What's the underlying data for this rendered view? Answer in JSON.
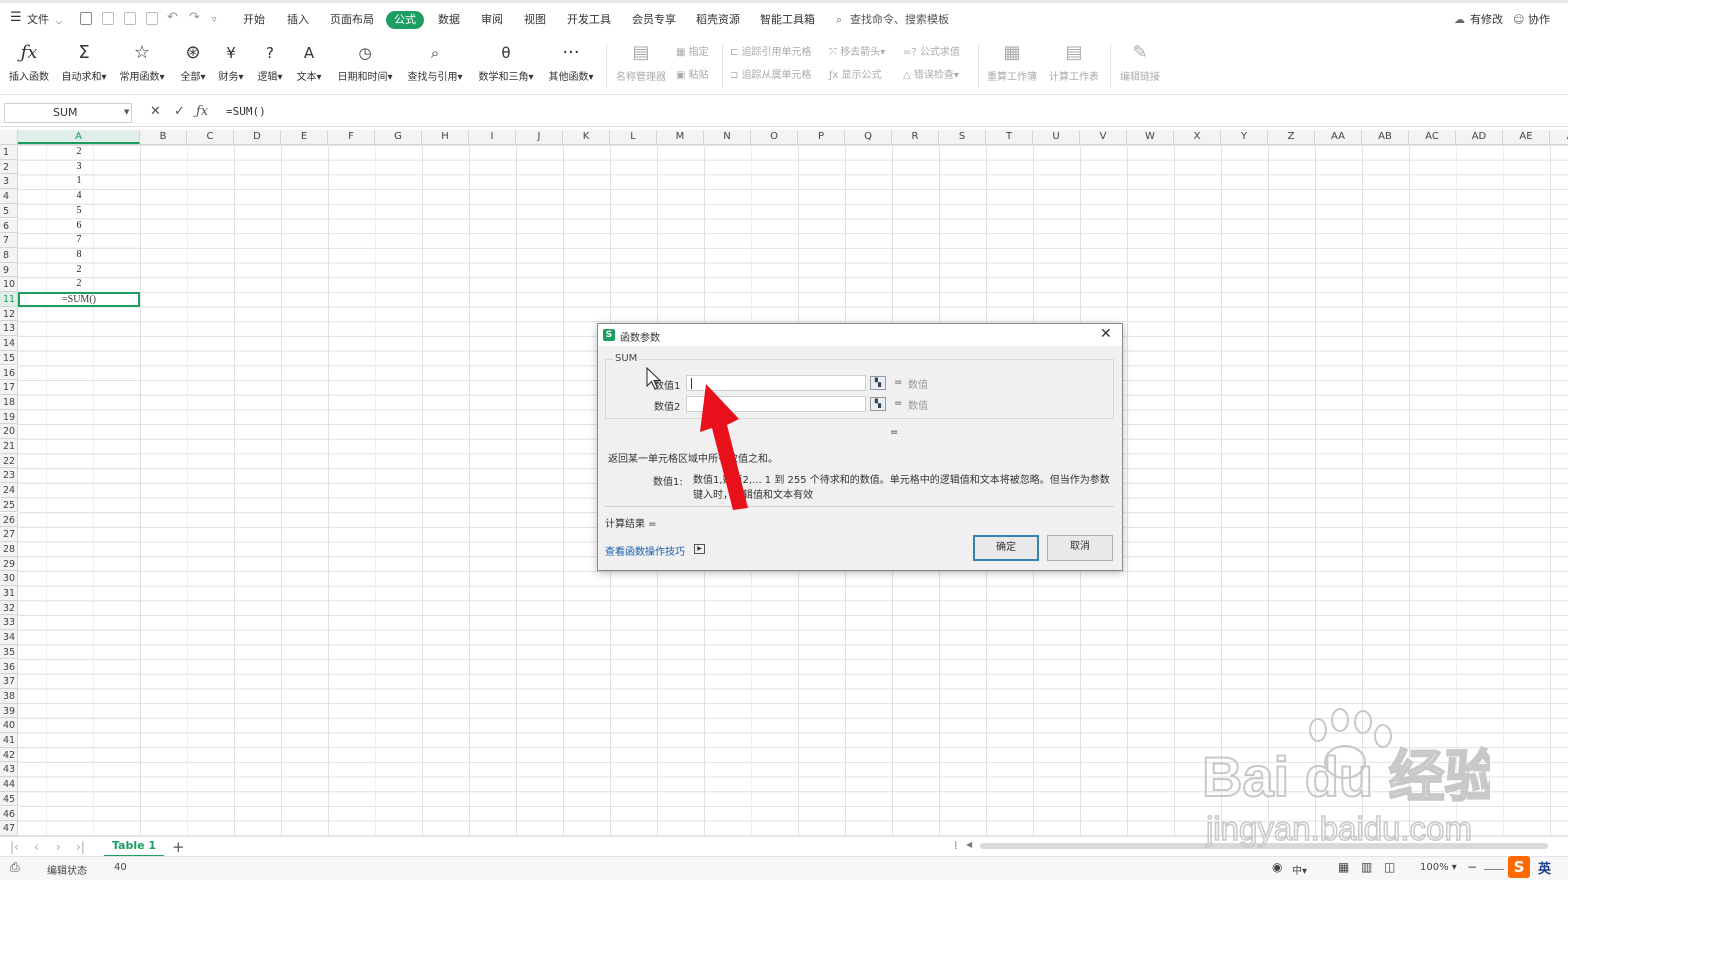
{
  "menubar": {
    "file": "文件",
    "tabs": [
      "开始",
      "插入",
      "页面布局",
      "公式",
      "数据",
      "审阅",
      "视图",
      "开发工具",
      "会员专享",
      "稻壳资源",
      "智能工具箱"
    ],
    "active_tab": "公式",
    "search": "查找命令、搜索模板",
    "changes": "有修改",
    "collab": "协作"
  },
  "ribbon": {
    "insert_fn": "插入函数",
    "autosum": "自动求和",
    "common": "常用函数",
    "all": "全部",
    "finance": "财务",
    "logic": "逻辑",
    "text": "文本",
    "datetime": "日期和时间",
    "lookup": "查找与引用",
    "math": "数学和三角",
    "other": "其他函数",
    "name_mgr": "名称管理器",
    "specify": "指定",
    "paste": "粘贴",
    "trace_prec": "追踪引用单元格",
    "trace_dep": "追踪从属单元格",
    "remove_arrows": "移去箭头",
    "show_formula": "显示公式",
    "eval_formula": "公式求值",
    "error_check": "错误检查",
    "recalc": "重算工作簿",
    "calc_sheet": "计算工作表",
    "edit_links": "编辑链接"
  },
  "formula_bar": {
    "name_box": "SUM",
    "formula": "=SUM()"
  },
  "grid": {
    "columns": [
      "A",
      "B",
      "C",
      "D",
      "E",
      "F",
      "G",
      "H",
      "I",
      "J",
      "K",
      "L",
      "M",
      "N",
      "O",
      "P",
      "Q",
      "R",
      "S",
      "T",
      "U",
      "V",
      "W",
      "X",
      "Y",
      "Z",
      "AA",
      "AB",
      "AC",
      "AD",
      "AE",
      "AF"
    ],
    "values": [
      "2",
      "3",
      "1",
      "4",
      "5",
      "6",
      "7",
      "8",
      "2",
      "2"
    ],
    "active_cell_text": "=SUM()",
    "row_count": 47
  },
  "sheets": {
    "tabs": [
      "Table 1"
    ]
  },
  "status": {
    "mode": "编辑状态",
    "count": "40",
    "zoom": "100%"
  },
  "dialog": {
    "title": "函数参数",
    "function": "SUM",
    "arg1_label": "数值1",
    "arg2_label": "数值2",
    "eq": "=",
    "hint": "数值",
    "result_eq": "=",
    "description": "返回某一单元格区域中所有数值之和。",
    "arg_desc_label": "数值1:",
    "arg_desc": "数值1,数值2,... 1 到 255 个待求和的数值。单元格中的逻辑值和文本将被忽略。但当作为参数键入时，逻辑值和文本有效",
    "calc_result": "计算结果 =",
    "help_link": "查看函数操作技巧",
    "ok": "确定",
    "cancel": "取消"
  },
  "watermark": {
    "brand": "Bai du 经验",
    "url": "jingyan.baidu.com"
  },
  "colors": {
    "accent": "#1e9d63",
    "arrow": "#e8101a",
    "link": "#1a5fb4"
  }
}
